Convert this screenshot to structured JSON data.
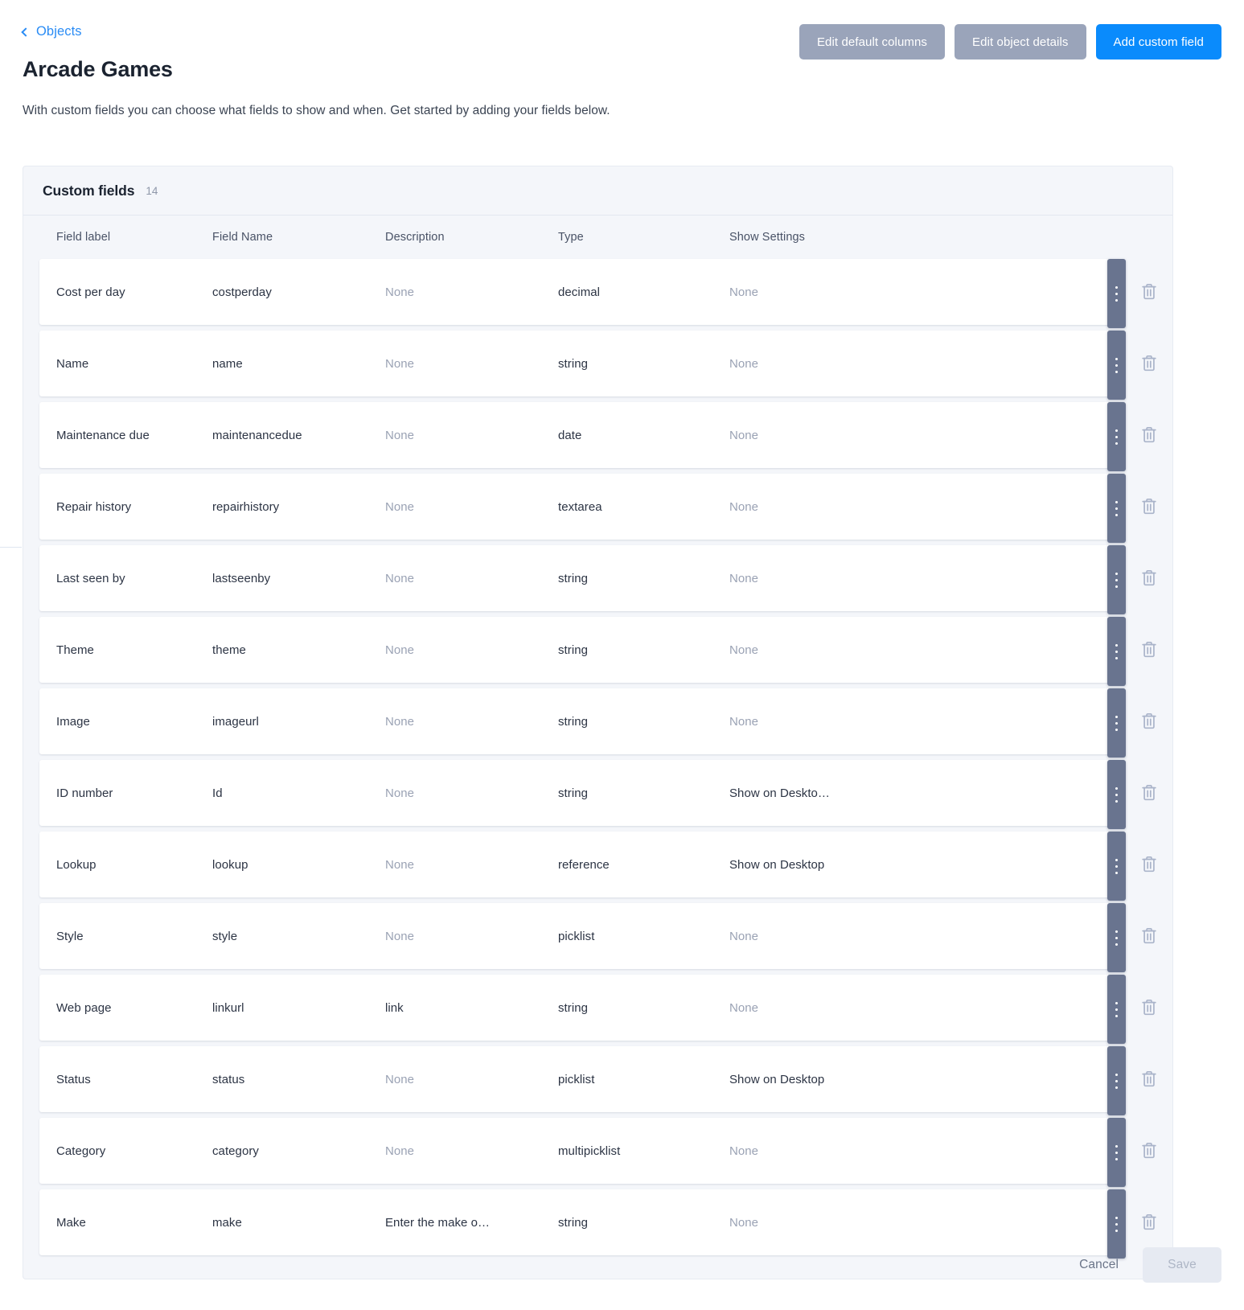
{
  "breadcrumb": {
    "label": "Objects",
    "icon": "chevron-left-icon"
  },
  "header": {
    "title": "Arcade Games",
    "subtitle": "With custom fields you can choose what fields to show and when. Get started by adding your fields below.",
    "actions": {
      "edit_default_columns": "Edit default columns",
      "edit_object_details": "Edit object details",
      "add_custom_field": "Add custom field"
    }
  },
  "card": {
    "title": "Custom fields",
    "count": "14",
    "columns": {
      "field_label": "Field label",
      "field_name": "Field Name",
      "description": "Description",
      "type": "Type",
      "show_settings": "Show Settings"
    },
    "rows": [
      {
        "label": "Cost per day",
        "name": "costperday",
        "description": "None",
        "description_muted": true,
        "type": "decimal",
        "settings": "None",
        "settings_muted": true
      },
      {
        "label": "Name",
        "name": "name",
        "description": "None",
        "description_muted": true,
        "type": "string",
        "settings": "None",
        "settings_muted": true
      },
      {
        "label": "Maintenance due",
        "name": "maintenancedue",
        "description": "None",
        "description_muted": true,
        "type": "date",
        "settings": "None",
        "settings_muted": true
      },
      {
        "label": "Repair history",
        "name": "repairhistory",
        "description": "None",
        "description_muted": true,
        "type": "textarea",
        "settings": "None",
        "settings_muted": true
      },
      {
        "label": "Last seen by",
        "name": "lastseenby",
        "description": "None",
        "description_muted": true,
        "type": "string",
        "settings": "None",
        "settings_muted": true
      },
      {
        "label": "Theme",
        "name": "theme",
        "description": "None",
        "description_muted": true,
        "type": "string",
        "settings": "None",
        "settings_muted": true
      },
      {
        "label": "Image",
        "name": "imageurl",
        "description": "None",
        "description_muted": true,
        "type": "string",
        "settings": "None",
        "settings_muted": true
      },
      {
        "label": "ID number",
        "name": "Id",
        "description": "None",
        "description_muted": true,
        "type": "string",
        "settings": "Show on Deskto…",
        "settings_muted": false
      },
      {
        "label": "Lookup",
        "name": "lookup",
        "description": "None",
        "description_muted": true,
        "type": "reference",
        "settings": "Show on Desktop",
        "settings_muted": false
      },
      {
        "label": "Style",
        "name": "style",
        "description": "None",
        "description_muted": true,
        "type": "picklist",
        "settings": "None",
        "settings_muted": true
      },
      {
        "label": "Web page",
        "name": "linkurl",
        "description": "link",
        "description_muted": false,
        "type": "string",
        "settings": "None",
        "settings_muted": true
      },
      {
        "label": "Status",
        "name": "status",
        "description": "None",
        "description_muted": true,
        "type": "picklist",
        "settings": "Show on Desktop",
        "settings_muted": false
      },
      {
        "label": "Category",
        "name": "category",
        "description": "None",
        "description_muted": true,
        "type": "multipicklist",
        "settings": "None",
        "settings_muted": true
      },
      {
        "label": "Make",
        "name": "make",
        "description": "Enter the make o…",
        "description_muted": false,
        "type": "string",
        "settings": "None",
        "settings_muted": true
      }
    ],
    "row_controls": {
      "drag_icon": "drag-handle-icon",
      "delete_icon": "trash-icon"
    }
  },
  "footer": {
    "cancel": "Cancel",
    "save": "Save"
  },
  "colors": {
    "primary": "#0a8bfc",
    "secondary_button": "#9aa4ba",
    "link": "#2a8cf5",
    "card_bg": "#f4f6fa",
    "drag_handle": "#69748f",
    "trash_icon": "#aab4ca",
    "muted_text": "#9aa2b4"
  }
}
